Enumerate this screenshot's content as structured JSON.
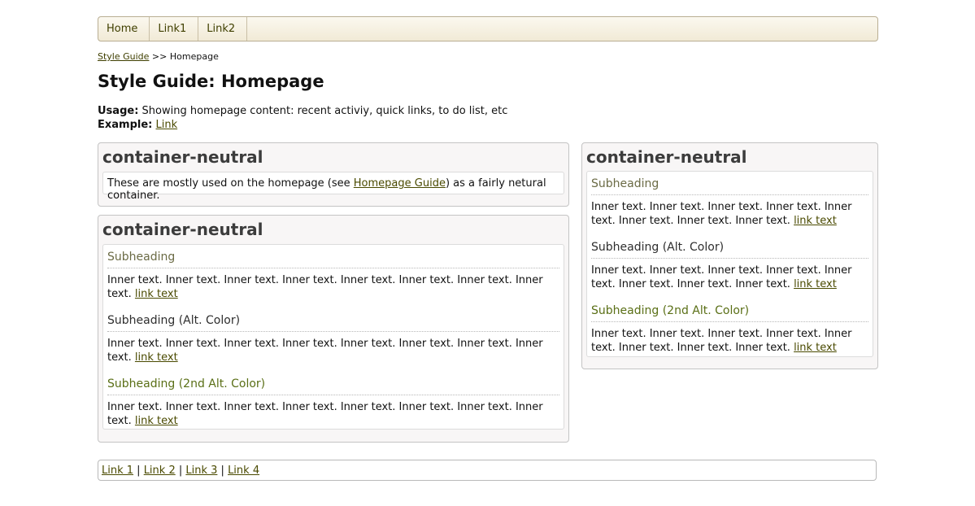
{
  "nav": {
    "items": [
      "Home",
      "Link1",
      "Link2"
    ]
  },
  "breadcrumb": {
    "link": "Style Guide",
    "sep": " >> ",
    "current": "Homepage"
  },
  "page_title": "Style Guide: Homepage",
  "usage": {
    "label": "Usage:",
    "text": " Showing homepage content: recent activiy, quick links, to do list, etc"
  },
  "example": {
    "label": "Example:",
    "link": "Link"
  },
  "box1": {
    "title": "container-neutral",
    "text_before": "These are mostly used on the homepage (see ",
    "link": "Homepage Guide",
    "text_after": ") as a fairly netural container."
  },
  "box2": {
    "title": "container-neutral",
    "sections": [
      {
        "heading": "Subheading",
        "text": "Inner text. Inner text. Inner text. Inner text. Inner text. Inner text. Inner text. Inner text. ",
        "link": "link text"
      },
      {
        "heading": "Subheading (Alt. Color)",
        "text": "Inner text. Inner text. Inner text. Inner text. Inner text. Inner text. Inner text. Inner text. ",
        "link": "link text"
      },
      {
        "heading": "Subheading (2nd Alt. Color)",
        "text": "Inner text. Inner text. Inner text. Inner text. Inner text. Inner text. Inner text. Inner text. ",
        "link": "link text"
      }
    ]
  },
  "box3": {
    "title": "container-neutral",
    "sections": [
      {
        "heading": "Subheading",
        "text": "Inner text. Inner text. Inner text. Inner text. Inner text. Inner text. Inner text. Inner text. ",
        "link": "link text"
      },
      {
        "heading": "Subheading (Alt. Color)",
        "text": "Inner text. Inner text. Inner text. Inner text. Inner text. Inner text. Inner text. Inner text. ",
        "link": "link text"
      },
      {
        "heading": "Subheading (2nd Alt. Color)",
        "text": "Inner text. Inner text. Inner text. Inner text. Inner text. Inner text. Inner text. Inner text. ",
        "link": "link text"
      }
    ]
  },
  "footer": {
    "links": [
      "Link 1",
      "Link 2",
      "Link 3",
      "Link 4"
    ],
    "sep": " | "
  },
  "colors": {
    "link": "#4a4a00",
    "subheading": "#6b6b45",
    "subheading_alt": "#2e2e2e",
    "subheading_alt2": "#5a6f16",
    "nav_bg": "#f1ead6"
  }
}
